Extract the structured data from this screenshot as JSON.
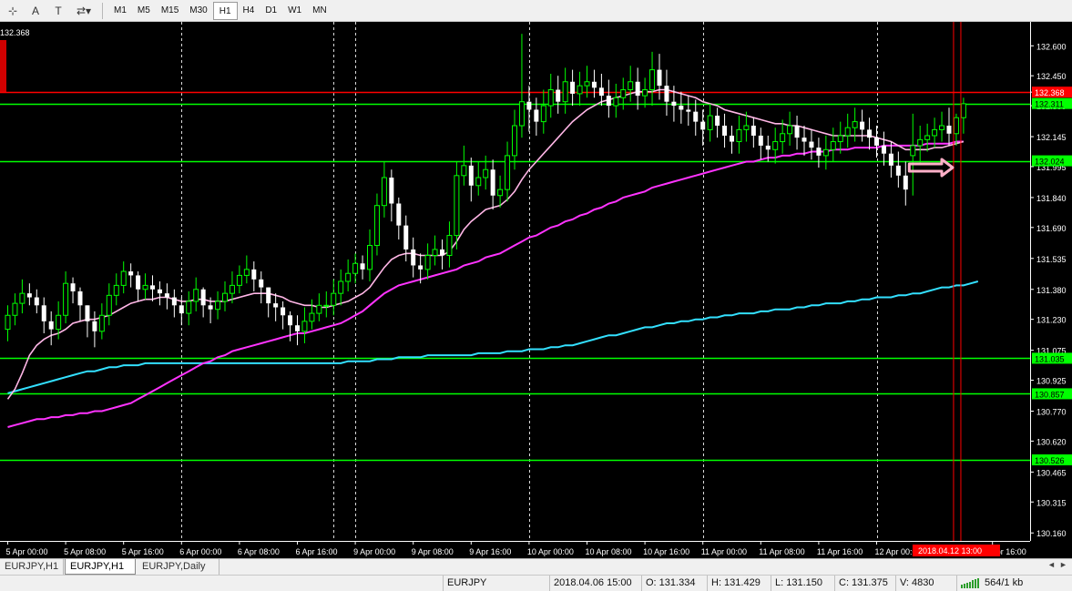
{
  "toolbar": {
    "icons": [
      "cursor-grid-icon",
      "letter-a-icon",
      "text-tool-icon",
      "arrows-dropdown-icon"
    ],
    "icon_glyphs": [
      "⊹",
      "A",
      "T",
      "⇄▾"
    ],
    "timeframes": [
      "M1",
      "M5",
      "M15",
      "M30",
      "H1",
      "H4",
      "D1",
      "W1",
      "MN"
    ],
    "active_timeframe": "H1"
  },
  "chart": {
    "price_label_top_left": "132.368",
    "colors": {
      "background": "#000000",
      "grid": "#ffffff",
      "bull_candle": "#00ff00",
      "bear_candle": "#ffffff",
      "h_line": "#00ff00",
      "red_line": "#ff0000",
      "ma_fast": "#ffb6e6",
      "ma_mid": "#ff33ff",
      "ma_slow": "#33e0ff",
      "arrow": "#ffb0c8"
    },
    "vertical_marker_label": "2018.04.12 13:00",
    "arrow_icon": "right-arrow-icon"
  },
  "chart_data": {
    "type": "candlestick",
    "symbol": "EURJPY",
    "timeframe": "H1",
    "ylim": [
      130.12,
      132.72
    ],
    "y_ticks": [
      132.6,
      132.45,
      132.368,
      132.3,
      132.145,
      131.995,
      131.84,
      131.69,
      131.535,
      131.38,
      131.23,
      131.075,
      130.925,
      130.77,
      130.62,
      130.465,
      130.315,
      130.16
    ],
    "y_tick_labels": [
      "132.600",
      "132.450",
      "132.368",
      "132.300",
      "132.145",
      "131.995",
      "131.840",
      "131.690",
      "131.535",
      "131.380",
      "131.230",
      "131.075",
      "130.925",
      "130.770",
      "130.620",
      "130.465",
      "130.315",
      "130.160"
    ],
    "x_ticks": [
      {
        "bar": 0,
        "label": "5 Apr 00:00"
      },
      {
        "bar": 8,
        "label": "5 Apr 08:00"
      },
      {
        "bar": 16,
        "label": "5 Apr 16:00"
      },
      {
        "bar": 24,
        "label": "6 Apr 00:00"
      },
      {
        "bar": 32,
        "label": "6 Apr 08:00"
      },
      {
        "bar": 40,
        "label": "6 Apr 16:00"
      },
      {
        "bar": 48,
        "label": "9 Apr 00:00"
      },
      {
        "bar": 56,
        "label": "9 Apr 08:00"
      },
      {
        "bar": 64,
        "label": "9 Apr 16:00"
      },
      {
        "bar": 72,
        "label": "10 Apr 00:00"
      },
      {
        "bar": 80,
        "label": "10 Apr 08:00"
      },
      {
        "bar": 88,
        "label": "10 Apr 16:00"
      },
      {
        "bar": 96,
        "label": "11 Apr 00:00"
      },
      {
        "bar": 104,
        "label": "11 Apr 08:00"
      },
      {
        "bar": 112,
        "label": "11 Apr 16:00"
      },
      {
        "bar": 120,
        "label": "12 Apr 00:00"
      },
      {
        "bar": 136,
        "label": "Apr 16:00"
      }
    ],
    "dashed_vertical_grid_bars": [
      24,
      45,
      48,
      72,
      96,
      120
    ],
    "marker_bar": 131,
    "horizontal_lines": [
      {
        "price": 132.311,
        "label": "132.311",
        "color": "#00ff00"
      },
      {
        "price": 132.024,
        "label": "132.024",
        "color": "#00ff00"
      },
      {
        "price": 131.035,
        "label": "131.035",
        "color": "#00ff00"
      },
      {
        "price": 130.857,
        "label": "130.857",
        "color": "#00ff00"
      },
      {
        "price": 130.526,
        "label": "130.526",
        "color": "#00ff00"
      },
      {
        "price": 132.368,
        "label": "132.368",
        "color": "#ff0000"
      }
    ],
    "arrow_annotation": {
      "bar_from": 124.5,
      "bar_to": 130.5,
      "price": 131.99
    },
    "candles": {
      "open": [
        131.18,
        131.25,
        131.31,
        131.36,
        131.34,
        131.3,
        131.22,
        131.18,
        131.25,
        131.41,
        131.37,
        131.3,
        131.22,
        131.17,
        131.25,
        131.35,
        131.4,
        131.47,
        131.45,
        131.38,
        131.4,
        131.38,
        131.36,
        131.34,
        131.3,
        131.26,
        131.32,
        131.38,
        131.3,
        131.28,
        131.32,
        131.36,
        131.4,
        131.45,
        131.48,
        131.43,
        131.39,
        131.31,
        131.29,
        131.25,
        131.2,
        131.17,
        131.22,
        131.26,
        131.3,
        131.3,
        131.36,
        131.42,
        131.46,
        131.51,
        131.48,
        131.6,
        131.8,
        131.94,
        131.81,
        131.7,
        131.58,
        131.5,
        131.48,
        131.55,
        131.58,
        131.55,
        131.65,
        131.95,
        132.0,
        131.9,
        131.94,
        131.98,
        131.85,
        131.88,
        132.05,
        132.2,
        132.32,
        132.28,
        132.22,
        132.3,
        132.38,
        132.32,
        132.42,
        132.36,
        132.4,
        132.42,
        132.39,
        132.35,
        132.3,
        132.34,
        132.38,
        132.42,
        132.35,
        132.38,
        132.48,
        132.4,
        132.32,
        132.3,
        132.28,
        132.27,
        132.22,
        132.18,
        132.25,
        132.2,
        132.15,
        132.12,
        132.18,
        132.2,
        132.15,
        132.1,
        132.08,
        132.12,
        132.16,
        132.2,
        132.14,
        132.12,
        132.09,
        132.05,
        132.08,
        132.12,
        132.15,
        132.19,
        132.22,
        132.18,
        132.14,
        132.1,
        132.06,
        132.0,
        131.95,
        132.05,
        132.1,
        132.13,
        132.15,
        132.18,
        132.2,
        132.16,
        132.24
      ],
      "close": [
        131.25,
        131.31,
        131.36,
        131.34,
        131.3,
        131.22,
        131.18,
        131.25,
        131.41,
        131.37,
        131.3,
        131.22,
        131.17,
        131.25,
        131.35,
        131.4,
        131.47,
        131.45,
        131.38,
        131.4,
        131.38,
        131.36,
        131.34,
        131.3,
        131.26,
        131.32,
        131.38,
        131.3,
        131.28,
        131.32,
        131.36,
        131.4,
        131.45,
        131.48,
        131.43,
        131.39,
        131.31,
        131.29,
        131.25,
        131.2,
        131.17,
        131.22,
        131.26,
        131.3,
        131.3,
        131.36,
        131.42,
        131.46,
        131.51,
        131.48,
        131.6,
        131.8,
        131.94,
        131.81,
        131.7,
        131.58,
        131.5,
        131.48,
        131.55,
        131.58,
        131.55,
        131.65,
        131.95,
        132.0,
        131.9,
        131.94,
        131.98,
        131.85,
        131.88,
        132.05,
        132.2,
        132.32,
        132.28,
        132.22,
        132.3,
        132.38,
        132.32,
        132.42,
        132.36,
        132.4,
        132.42,
        132.39,
        132.35,
        132.3,
        132.34,
        132.38,
        132.42,
        132.35,
        132.38,
        132.48,
        132.4,
        132.32,
        132.3,
        132.28,
        132.27,
        132.22,
        132.18,
        132.25,
        132.2,
        132.15,
        132.12,
        132.18,
        132.2,
        132.15,
        132.1,
        132.08,
        132.12,
        132.16,
        132.2,
        132.14,
        132.12,
        132.09,
        132.05,
        132.08,
        132.12,
        132.15,
        132.19,
        132.22,
        132.18,
        132.14,
        132.1,
        132.06,
        132.0,
        131.95,
        131.88,
        132.1,
        132.13,
        132.15,
        132.18,
        132.2,
        132.16,
        132.24,
        132.31
      ],
      "high": [
        131.3,
        131.36,
        131.43,
        131.41,
        131.38,
        131.34,
        131.27,
        131.32,
        131.47,
        131.44,
        131.39,
        131.3,
        131.27,
        131.31,
        131.41,
        131.46,
        131.52,
        131.51,
        131.47,
        131.46,
        131.45,
        131.42,
        131.41,
        131.38,
        131.34,
        131.37,
        131.44,
        131.39,
        131.34,
        131.37,
        131.42,
        131.47,
        131.5,
        131.55,
        131.52,
        131.47,
        131.39,
        131.36,
        131.32,
        131.27,
        131.25,
        131.29,
        131.33,
        131.36,
        131.37,
        131.43,
        131.48,
        131.53,
        131.56,
        131.55,
        131.68,
        131.86,
        132.02,
        131.98,
        131.84,
        131.75,
        131.64,
        131.56,
        131.61,
        131.65,
        131.63,
        131.72,
        132.02,
        132.1,
        132.04,
        132.02,
        132.05,
        132.03,
        131.95,
        132.12,
        132.28,
        132.66,
        132.4,
        132.34,
        132.38,
        132.46,
        132.45,
        132.49,
        132.48,
        132.47,
        132.5,
        132.48,
        132.46,
        132.43,
        132.41,
        132.44,
        132.5,
        132.49,
        132.44,
        132.57,
        132.56,
        132.48,
        132.4,
        132.37,
        132.35,
        132.33,
        132.28,
        132.31,
        132.29,
        132.26,
        132.2,
        132.25,
        132.27,
        132.24,
        132.19,
        132.15,
        132.19,
        132.23,
        132.27,
        132.25,
        132.2,
        132.18,
        132.14,
        132.15,
        132.19,
        132.22,
        132.26,
        132.29,
        132.28,
        132.24,
        132.2,
        132.17,
        132.12,
        132.07,
        132.02,
        132.26,
        132.2,
        132.21,
        132.24,
        132.27,
        132.29,
        132.26,
        132.34
      ],
      "low": [
        131.12,
        131.2,
        131.26,
        131.3,
        131.26,
        131.16,
        131.1,
        131.13,
        131.21,
        131.31,
        131.22,
        131.14,
        131.09,
        131.13,
        131.2,
        131.3,
        131.36,
        131.39,
        131.32,
        131.33,
        131.32,
        131.3,
        131.28,
        131.24,
        131.2,
        131.2,
        131.27,
        131.24,
        131.21,
        131.23,
        131.27,
        131.31,
        131.36,
        131.41,
        131.37,
        131.31,
        131.24,
        131.22,
        131.18,
        131.12,
        131.1,
        131.11,
        131.18,
        131.22,
        131.24,
        131.25,
        131.3,
        131.37,
        131.41,
        131.43,
        131.42,
        131.55,
        131.74,
        131.72,
        131.63,
        131.52,
        131.44,
        131.41,
        131.43,
        131.5,
        131.48,
        131.49,
        131.58,
        131.9,
        131.82,
        131.85,
        131.88,
        131.78,
        131.79,
        131.82,
        131.98,
        132.14,
        132.17,
        132.15,
        132.16,
        132.24,
        132.26,
        132.26,
        132.3,
        132.3,
        132.34,
        132.34,
        132.3,
        132.24,
        132.24,
        132.28,
        132.32,
        132.28,
        132.29,
        132.3,
        132.33,
        132.25,
        132.22,
        132.21,
        132.2,
        132.15,
        132.1,
        132.12,
        132.14,
        132.09,
        132.06,
        132.06,
        132.12,
        132.09,
        132.03,
        132.02,
        132.01,
        132.06,
        132.1,
        132.08,
        132.05,
        132.03,
        131.99,
        131.98,
        132.02,
        132.06,
        132.09,
        132.12,
        132.12,
        132.08,
        132.04,
        132.0,
        131.94,
        131.89,
        131.8,
        131.85,
        132.01,
        132.07,
        132.09,
        132.12,
        132.1,
        132.1,
        132.16
      ]
    },
    "ma_fast": [
      130.83,
      130.88,
      130.96,
      131.05,
      131.1,
      131.13,
      131.15,
      131.16,
      131.18,
      131.21,
      131.22,
      131.23,
      131.23,
      131.24,
      131.25,
      131.27,
      131.29,
      131.31,
      131.32,
      131.33,
      131.33,
      131.34,
      131.34,
      131.33,
      131.32,
      131.32,
      131.33,
      131.33,
      131.32,
      131.32,
      131.32,
      131.33,
      131.34,
      131.35,
      131.36,
      131.36,
      131.36,
      131.35,
      131.34,
      131.32,
      131.31,
      131.3,
      131.3,
      131.29,
      131.29,
      131.3,
      131.31,
      131.32,
      131.34,
      131.36,
      131.39,
      131.44,
      131.49,
      131.53,
      131.55,
      131.56,
      131.56,
      131.55,
      131.55,
      131.55,
      131.55,
      131.57,
      131.62,
      131.68,
      131.72,
      131.75,
      131.78,
      131.79,
      131.8,
      131.83,
      131.87,
      131.93,
      131.98,
      132.02,
      132.06,
      132.1,
      132.14,
      132.18,
      132.22,
      132.25,
      132.28,
      132.3,
      132.32,
      132.33,
      132.34,
      132.35,
      132.36,
      132.37,
      132.37,
      132.37,
      132.38,
      132.38,
      132.37,
      132.36,
      132.35,
      132.34,
      132.32,
      132.31,
      132.3,
      132.28,
      132.27,
      132.26,
      132.25,
      132.24,
      132.23,
      132.22,
      132.21,
      132.21,
      132.2,
      132.2,
      132.19,
      132.18,
      132.17,
      132.16,
      132.15,
      132.15,
      132.15,
      132.15,
      132.15,
      132.15,
      132.14,
      132.13,
      132.12,
      132.1,
      132.08,
      132.08,
      132.08,
      132.08,
      132.09,
      132.09,
      132.1,
      132.11,
      132.12
    ],
    "ma_mid": [
      130.69,
      130.7,
      130.71,
      130.72,
      130.73,
      130.73,
      130.74,
      130.74,
      130.75,
      130.75,
      130.76,
      130.76,
      130.77,
      130.77,
      130.78,
      130.79,
      130.8,
      130.81,
      130.83,
      130.85,
      130.87,
      130.89,
      130.91,
      130.93,
      130.95,
      130.97,
      130.99,
      131.01,
      131.02,
      131.04,
      131.05,
      131.07,
      131.08,
      131.09,
      131.1,
      131.11,
      131.12,
      131.13,
      131.14,
      131.15,
      131.16,
      131.16,
      131.17,
      131.18,
      131.19,
      131.2,
      131.21,
      131.23,
      131.25,
      131.27,
      131.3,
      131.33,
      131.36,
      131.38,
      131.4,
      131.41,
      131.42,
      131.43,
      131.44,
      131.45,
      131.46,
      131.47,
      131.48,
      131.5,
      131.51,
      131.52,
      131.54,
      131.55,
      131.56,
      131.58,
      131.6,
      131.62,
      131.64,
      131.65,
      131.67,
      131.69,
      131.7,
      131.72,
      131.73,
      131.75,
      131.76,
      131.78,
      131.79,
      131.81,
      131.82,
      131.84,
      131.85,
      131.86,
      131.87,
      131.89,
      131.9,
      131.91,
      131.92,
      131.93,
      131.94,
      131.95,
      131.96,
      131.97,
      131.98,
      131.99,
      132.0,
      132.01,
      132.02,
      132.02,
      132.03,
      132.04,
      132.04,
      132.05,
      132.05,
      132.06,
      132.06,
      132.07,
      132.07,
      132.07,
      132.08,
      132.08,
      132.08,
      132.09,
      132.09,
      132.09,
      132.09,
      132.1,
      132.1,
      132.1,
      132.1,
      132.1,
      132.1,
      132.11,
      132.11,
      132.11,
      132.11,
      132.12,
      132.12
    ],
    "ma_slow": [
      130.86,
      130.87,
      130.88,
      130.89,
      130.9,
      130.91,
      130.92,
      130.93,
      130.94,
      130.95,
      130.96,
      130.97,
      130.97,
      130.98,
      130.99,
      130.99,
      131.0,
      131.0,
      131.0,
      131.01,
      131.01,
      131.01,
      131.01,
      131.01,
      131.01,
      131.01,
      131.01,
      131.01,
      131.01,
      131.01,
      131.01,
      131.01,
      131.01,
      131.01,
      131.01,
      131.01,
      131.01,
      131.01,
      131.01,
      131.01,
      131.01,
      131.01,
      131.01,
      131.01,
      131.01,
      131.01,
      131.01,
      131.02,
      131.02,
      131.02,
      131.02,
      131.03,
      131.03,
      131.03,
      131.04,
      131.04,
      131.04,
      131.04,
      131.05,
      131.05,
      131.05,
      131.05,
      131.05,
      131.05,
      131.05,
      131.06,
      131.06,
      131.06,
      131.06,
      131.07,
      131.07,
      131.07,
      131.08,
      131.08,
      131.08,
      131.09,
      131.09,
      131.1,
      131.1,
      131.11,
      131.12,
      131.13,
      131.14,
      131.15,
      131.15,
      131.16,
      131.17,
      131.18,
      131.19,
      131.19,
      131.2,
      131.21,
      131.21,
      131.22,
      131.22,
      131.23,
      131.23,
      131.24,
      131.24,
      131.25,
      131.25,
      131.26,
      131.26,
      131.26,
      131.27,
      131.27,
      131.28,
      131.28,
      131.28,
      131.29,
      131.29,
      131.3,
      131.3,
      131.31,
      131.31,
      131.31,
      131.32,
      131.32,
      131.33,
      131.33,
      131.34,
      131.34,
      131.34,
      131.35,
      131.35,
      131.36,
      131.36,
      131.37,
      131.38,
      131.39,
      131.39,
      131.4,
      131.4,
      131.41,
      131.42
    ]
  },
  "tabs": {
    "items": [
      "EURJPY,H1",
      "EURJPY,H1",
      "EURJPY,Daily"
    ],
    "active_index": 1,
    "arrow_left": "◄",
    "arrow_right": "►"
  },
  "status": {
    "symbol": "EURJPY",
    "datetime": "2018.04.06 15:00",
    "open": "O: 131.334",
    "high": "H: 131.429",
    "low": "L: 131.150",
    "close": "C: 131.375",
    "volume": "V: 4830",
    "traffic": "564/1 kb"
  }
}
